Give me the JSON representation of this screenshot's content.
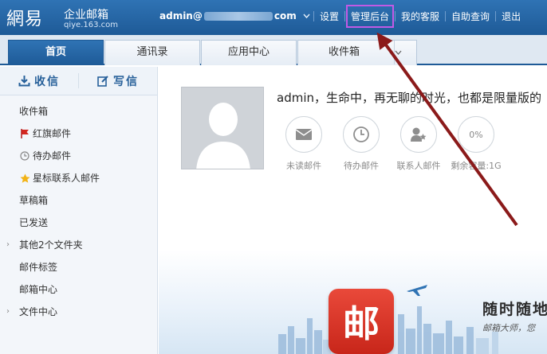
{
  "header": {
    "logo_main": "網易",
    "logo_sub": "企业邮箱",
    "logo_domain": "qiye.163.com",
    "account_prefix": "admin@",
    "account_suffix": "com",
    "nav": [
      "设置",
      "管理后台",
      "我的客服",
      "自助查询",
      "退出"
    ],
    "highlighted_nav": "管理后台"
  },
  "tabs": [
    "首页",
    "通讯录",
    "应用中心",
    "收件箱"
  ],
  "sidebar": {
    "receive": "收信",
    "write": "写信",
    "folders": [
      "收件箱",
      "红旗邮件",
      "待办邮件",
      "星标联系人邮件",
      "草稿箱",
      "已发送",
      "其他2个文件夹",
      "邮件标签",
      "邮箱中心",
      "文件中心"
    ]
  },
  "main": {
    "greeting": "admin，生命中，再无聊的时光，也都是限量版的",
    "stats": [
      {
        "label": "未读邮件",
        "icon": "envelope-icon"
      },
      {
        "label": "待办邮件",
        "icon": "clock-icon"
      },
      {
        "label": "联系人邮件",
        "icon": "contact-star-icon"
      },
      {
        "label": "剩余容量:1G",
        "value": "0%"
      }
    ]
  },
  "banner": {
    "icon_char": "邮",
    "title": "随时随地",
    "subtitle": "邮箱大师，您"
  },
  "colors": {
    "header_blue": "#1e5a97",
    "highlight_purple": "#c25ae5",
    "arrow_red": "#8b1a1a"
  }
}
